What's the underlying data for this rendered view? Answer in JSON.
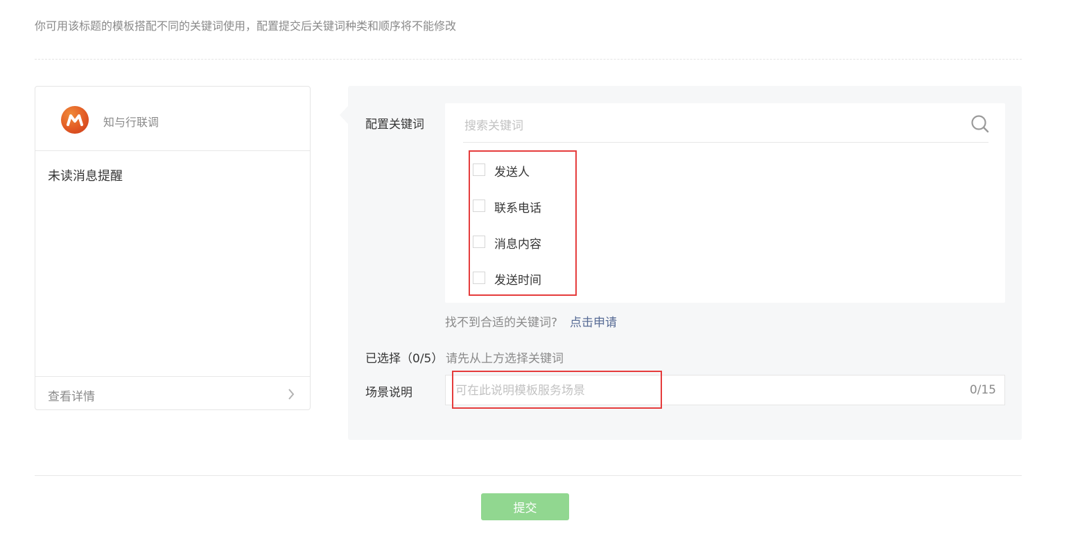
{
  "hint": "你可用该标题的模板搭配不同的关键词使用，配置提交后关键词种类和顺序将不能修改",
  "preview": {
    "brand": "知与行联调",
    "title": "未读消息提醒",
    "detail_label": "查看详情",
    "logo_icon": "m-logo",
    "detail_icon": "chevron-right-icon"
  },
  "config": {
    "keywords_label": "配置关键词",
    "search": {
      "placeholder": "搜索关键词",
      "icon": "search-icon"
    },
    "keywords": [
      {
        "label": "发送人",
        "checked": false
      },
      {
        "label": "联系电话",
        "checked": false
      },
      {
        "label": "消息内容",
        "checked": false
      },
      {
        "label": "发送时间",
        "checked": false
      }
    ],
    "not_found_text": "找不到合适的关键词?",
    "apply_link": "点击申请",
    "selected_label": "已选择（0/5）",
    "selected_hint": "请先从上方选择关键词",
    "scene_label": "场景说明",
    "scene_placeholder": "可在此说明模板服务场景",
    "scene_counter": "0/15"
  },
  "submit_label": "提交",
  "colors": {
    "panel_bg": "#f6f7f8",
    "submit_bg": "#91d790",
    "link": "#576b95",
    "highlight": "#e53b3b",
    "logo": "#e25a24"
  }
}
